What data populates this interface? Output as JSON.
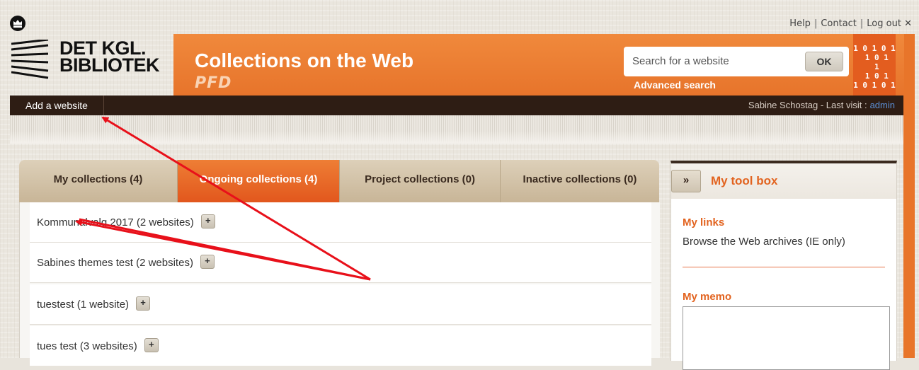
{
  "top_links": [
    "Help",
    "Contact",
    "Log out"
  ],
  "close_glyph": "✕",
  "logo": {
    "text": "DET KGL.\nBIBLIOTEK"
  },
  "banner": {
    "title": "Collections on the Web",
    "subtitle": "PFD",
    "search_placeholder": "Search for a website",
    "search_button": "OK",
    "advanced_search": "Advanced search",
    "binary_text": "1 0 1 0 1\n 1 0 1\n 1\n 1 0 1\n1 0 1 0 1"
  },
  "nav": {
    "add_website": "Add a website",
    "user_text": "Sabine Schostag - Last visit :",
    "admin_link": "admin"
  },
  "tabs": [
    {
      "label": "My collections (4)",
      "active": false
    },
    {
      "label": "Ongoing collections (4)",
      "active": true
    },
    {
      "label": "Project collections (0)",
      "active": false
    },
    {
      "label": "Inactive collections (0)",
      "active": false
    }
  ],
  "collections": [
    {
      "label": "Kommunalvalg 2017 (2 websites)"
    },
    {
      "label": "Sabines themes test (2 websites)"
    },
    {
      "label": "tuestest (1 website)"
    },
    {
      "label": "tues test (3 websites)"
    }
  ],
  "plus_glyph": "+",
  "toolbox": {
    "toggle": "»",
    "title": "My tool box",
    "links_title": "My links",
    "link": "Browse the Web archives (IE only)",
    "memo_title": "My memo"
  },
  "colors": {
    "orange": "#e8752a",
    "dark_brown": "#2e1d14",
    "annotation_red": "#e8101a"
  }
}
